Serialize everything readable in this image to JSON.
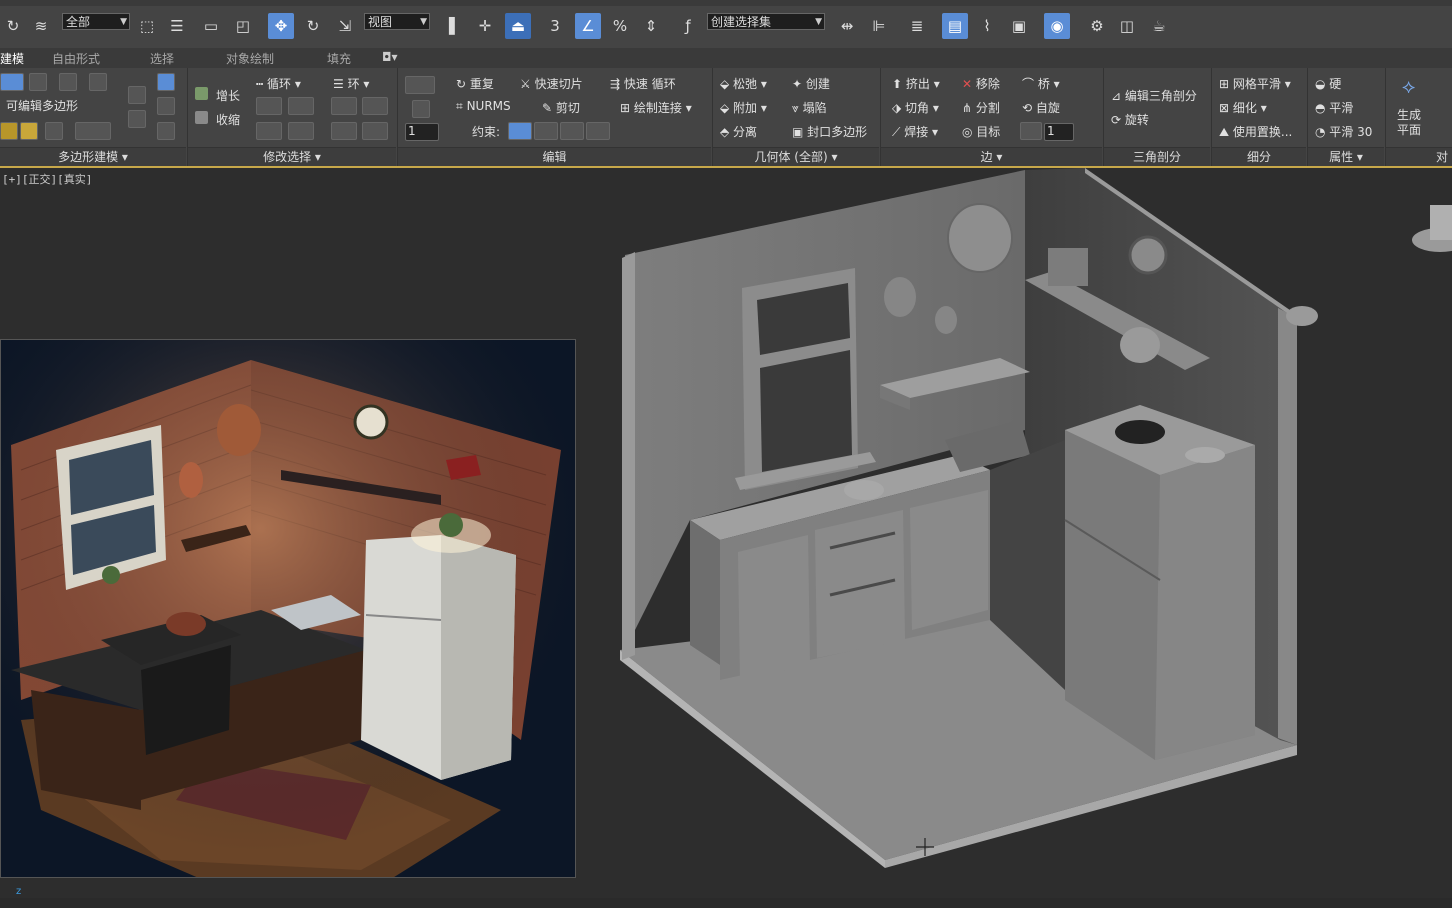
{
  "toolbar": {
    "selection_filter": "全部",
    "reference_coord": "视图",
    "named_selection": "创建选择集",
    "snap_label": "3",
    "percent_snap": "%"
  },
  "tabs": [
    {
      "label": "建模",
      "active": true
    },
    {
      "label": "自由形式",
      "active": false
    },
    {
      "label": "选择",
      "active": false
    },
    {
      "label": "对象绘制",
      "active": false
    },
    {
      "label": "填充",
      "active": false
    }
  ],
  "ribbon": {
    "poly_modeling": {
      "title": "可编辑多边形",
      "footer": "多边形建模"
    },
    "modify_selection": {
      "grow": "增长",
      "shrink": "收缩",
      "loop": "循环",
      "ring": "环",
      "footer": "修改选择"
    },
    "edit": {
      "repeat": "重复",
      "quickslice": "快速切片",
      "swiftloop": "快速 循环",
      "nurms": "NURMS",
      "cut": "剪切",
      "paint_connect": "绘制连接",
      "constraints": "约束:",
      "spinner_value": "1",
      "footer": "编辑"
    },
    "geometry": {
      "relax": "松弛",
      "create": "创建",
      "attach": "附加",
      "collapse": "塌陷",
      "detach": "分离",
      "cap_poly": "封口多边形",
      "footer": "几何体 (全部)"
    },
    "edges": {
      "extrude": "挤出",
      "remove": "移除",
      "bridge": "桥",
      "chamfer": "切角",
      "split": "分割",
      "spin": "自旋",
      "weld": "焊接",
      "target": "目标",
      "spinner_value": "1",
      "footer": "边"
    },
    "triangulation": {
      "edit_tri": "编辑三角剖分",
      "turn": "旋转",
      "footer": "三角剖分"
    },
    "subdivision": {
      "meshsmooth": "网格平滑",
      "tessellate": "细化",
      "use_displace": "使用置换...",
      "footer": "细分"
    },
    "properties": {
      "hard": "硬",
      "smooth": "平滑",
      "smooth30": "平滑 30",
      "footer": "属性"
    },
    "align": {
      "make_planar": "生成平面",
      "footer": "对"
    }
  },
  "viewport": {
    "label": "[+][正交][真实]"
  },
  "colors": {
    "accent_blue": "#5a8dd6",
    "viewport_bg": "#2d2d2d",
    "ribbon_bg": "#444444",
    "gold_line": "#c7a84a"
  }
}
